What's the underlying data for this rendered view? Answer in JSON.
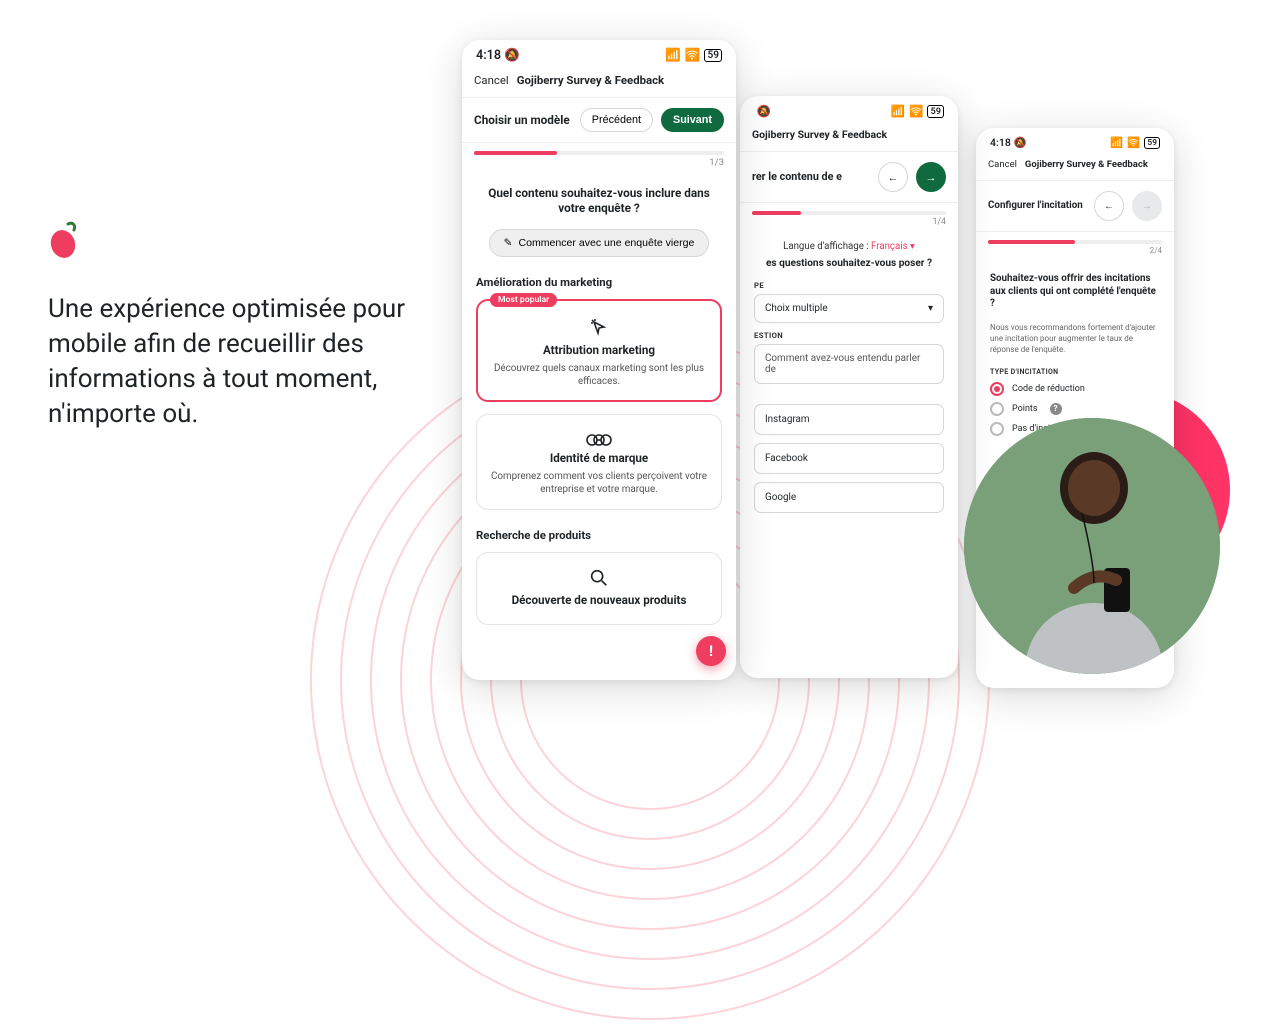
{
  "hero": {
    "headline": "Une expérience optimisée pour mobile afin de recueillir des informations à tout moment, n'importe où."
  },
  "statusbar": {
    "time": "4:18"
  },
  "app_title": "Gojiberry Survey & Feedback",
  "cancel_label": "Cancel",
  "phone1": {
    "step_label": "Choisir un modèle",
    "prev": "Précédent",
    "next": "Suivant",
    "progress_count": "1/3",
    "question": "Quel contenu souhaitez-vous inclure dans votre enquête ?",
    "blank_btn": "Commencer avec une enquête vierge",
    "section1": "Amélioration du marketing",
    "card1_tag": "Most popular",
    "card1_title": "Attribution marketing",
    "card1_desc": "Découvrez quels canaux marketing sont les plus efficaces.",
    "card2_title": "Identité de marque",
    "card2_desc": "Comprenez comment vos clients perçoivent votre entreprise et votre marque.",
    "section2": "Recherche de produits",
    "card3_title": "Découverte de nouveaux produits"
  },
  "phone2": {
    "step_label": "rer le contenu de e",
    "progress_count": "1/4",
    "lang_label": "Langue d'affichage :",
    "lang_value": "Français",
    "question": "es questions souhaitez-vous poser ?",
    "type_label": "PE",
    "type_value": "Choix multiple",
    "q_label": "ESTION",
    "q_value": "Comment avez-vous entendu parler de",
    "options": [
      "Instagram",
      "Facebook",
      "Google"
    ]
  },
  "phone3": {
    "step_label": "Configurer l'incitation",
    "progress_count": "2/4",
    "question": "Souhaitez-vous offrir des incitations aux clients qui ont complété l'enquête ?",
    "desc": "Nous vous recommandons fortement d'ajouter une incitation pour augmenter le taux de réponse de l'enquête.",
    "type_label": "TYPE D'INCITATION",
    "opt1": "Code de réduction",
    "opt2": "Points",
    "opt3": "Pas d'incitation"
  }
}
